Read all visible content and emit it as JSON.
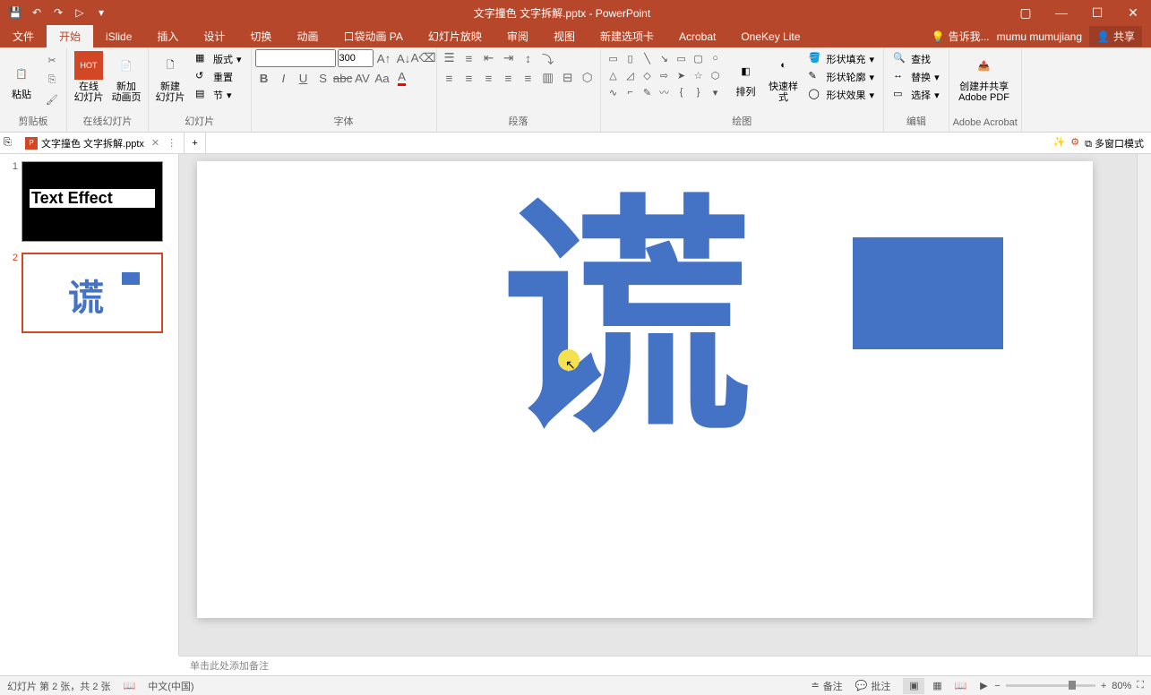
{
  "title": "文字撞色 文字拆解.pptx - PowerPoint",
  "qat": [
    "save",
    "undo",
    "redo",
    "start-from-beginning",
    "more"
  ],
  "win": {
    "ribbon_opts": "▢",
    "min": "—",
    "max": "☐",
    "close": "✕"
  },
  "tabs": {
    "file": "文件",
    "home": "开始",
    "islide": "iSlide",
    "insert": "插入",
    "design": "设计",
    "transitions": "切换",
    "animations": "动画",
    "pocket": "口袋动画 PA",
    "slideshow": "幻灯片放映",
    "review": "审阅",
    "view": "视图",
    "newtab": "新建选项卡",
    "acrobat": "Acrobat",
    "onekey": "OneKey Lite",
    "tellme": "告诉我...",
    "user": "mumu mumujiang",
    "share": "共享"
  },
  "groups": {
    "clipboard": {
      "paste": "粘贴",
      "label": "剪贴板"
    },
    "online": {
      "slides": "在线\n幻灯片",
      "anim": "新加\n动画页",
      "label": "在线幻灯片"
    },
    "slides": {
      "new": "新建\n幻灯片",
      "layout": "版式",
      "reset": "重置",
      "section": "节",
      "label": "幻灯片"
    },
    "font": {
      "size": "300",
      "label": "字体"
    },
    "paragraph": {
      "label": "段落"
    },
    "drawing": {
      "arrange": "排列",
      "quick": "快速样式",
      "fill": "形状填充",
      "outline": "形状轮廓",
      "effects": "形状效果",
      "label": "绘图"
    },
    "editing": {
      "find": "查找",
      "replace": "替换",
      "select": "选择",
      "label": "编辑"
    },
    "acrobat": {
      "create": "创建并共享\nAdobe PDF",
      "label": "Adobe Acrobat"
    }
  },
  "file_tab": {
    "name": "文字撞色 文字拆解.pptx",
    "multi": "多窗口模式"
  },
  "slides": {
    "s1": {
      "num": "1",
      "text": "Text Effect"
    },
    "s2": {
      "num": "2",
      "char": "谎"
    }
  },
  "canvas": {
    "char": "谎"
  },
  "notes_placeholder": "单击此处添加备注",
  "status": {
    "slide": "幻灯片 第 2 张，共 2 张",
    "lang": "中文(中国)",
    "notes": "备注",
    "comments": "批注",
    "zoom": "80%"
  }
}
